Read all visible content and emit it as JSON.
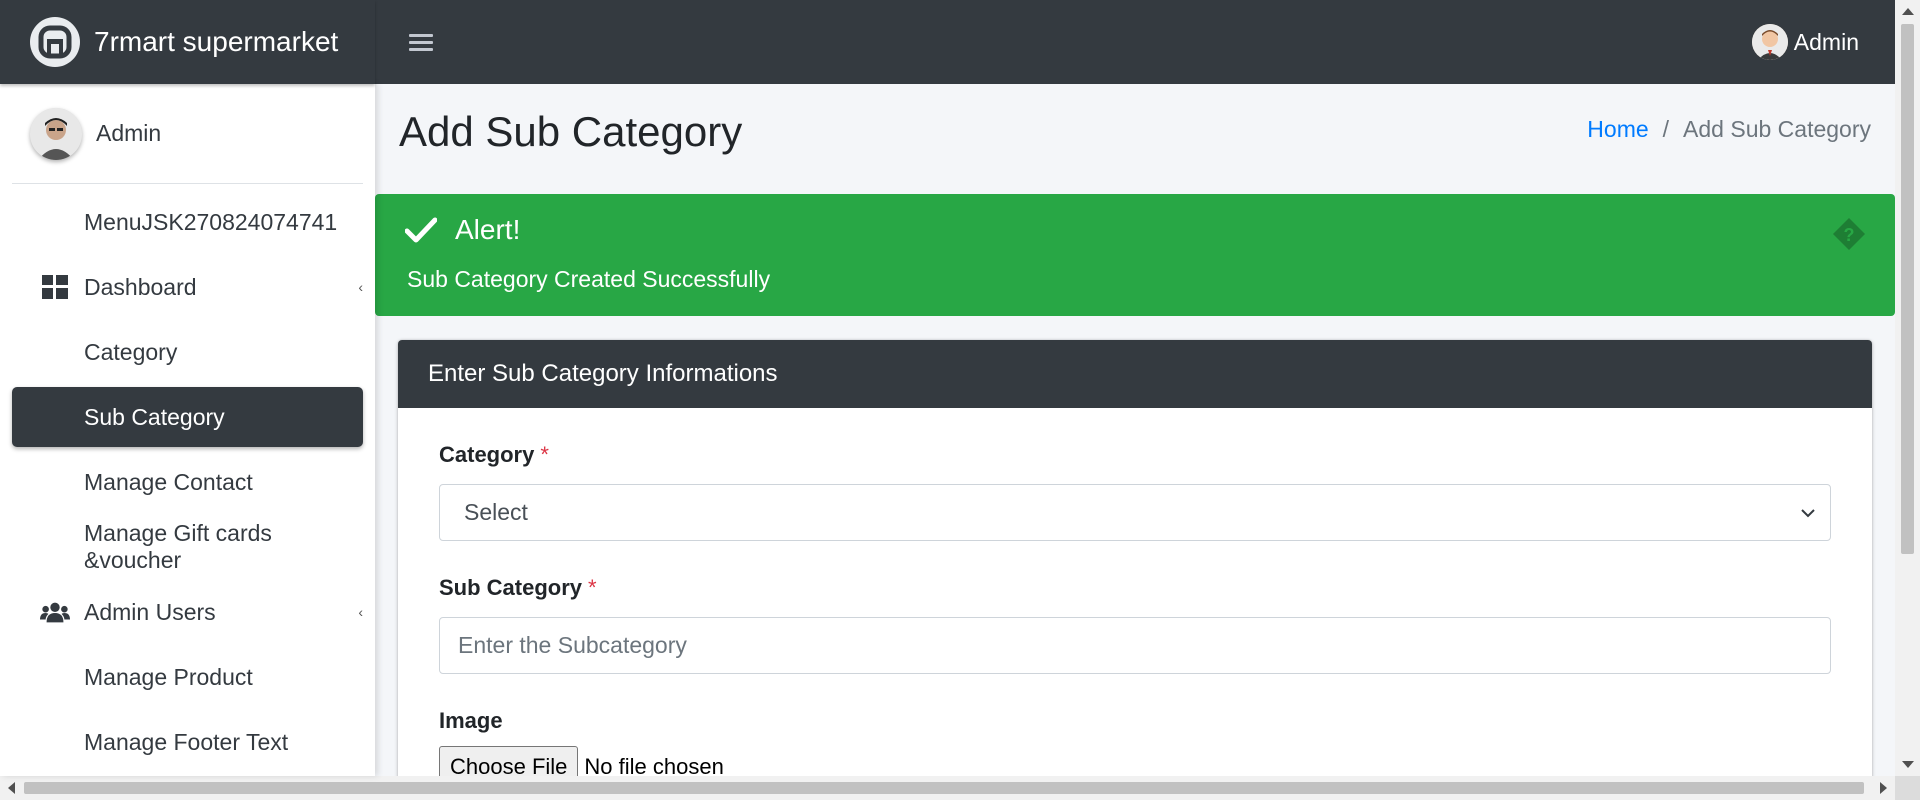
{
  "brand": {
    "name": "7rmart supermarket"
  },
  "topbar": {
    "user_name": "Admin"
  },
  "sidebar": {
    "user_name": "Admin",
    "items": [
      {
        "label": "MenuJSK270824074741",
        "icon": ""
      },
      {
        "label": "Dashboard",
        "icon": "dashboard-icon",
        "has_caret": true
      },
      {
        "label": "Category",
        "icon": ""
      },
      {
        "label": "Sub Category",
        "icon": "",
        "active": true
      },
      {
        "label": "Manage Contact",
        "icon": ""
      },
      {
        "label": "Manage Gift cards &voucher",
        "icon": ""
      },
      {
        "label": "Admin Users",
        "icon": "users-icon",
        "has_caret": true
      },
      {
        "label": "Manage Product",
        "icon": ""
      },
      {
        "label": "Manage Footer Text",
        "icon": ""
      }
    ]
  },
  "page": {
    "title": "Add Sub Category",
    "breadcrumb": {
      "home": "Home",
      "separator": "/",
      "current": "Add Sub Category"
    }
  },
  "alert": {
    "title": "Alert!",
    "message": "Sub Category Created Successfully",
    "color": "#28a745"
  },
  "form": {
    "header": "Enter Sub Category Informations",
    "category": {
      "label": "Category",
      "required_mark": "*",
      "selected": "Select"
    },
    "sub_category": {
      "label": "Sub Category",
      "required_mark": "*",
      "placeholder": "Enter the Subcategory",
      "value": ""
    },
    "image": {
      "label": "Image",
      "button": "Choose File",
      "status": "No file chosen"
    }
  },
  "colors": {
    "dark": "#343a40",
    "link": "#007bff",
    "required": "#dc3545"
  }
}
